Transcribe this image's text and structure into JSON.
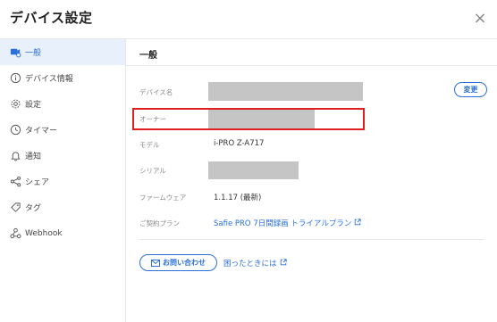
{
  "header": {
    "title": "デバイス設定",
    "close_glyph": "×"
  },
  "sidebar": {
    "items": [
      {
        "label": "一般",
        "icon": "camera-settings-icon",
        "active": true
      },
      {
        "label": "デバイス情報",
        "icon": "info-icon"
      },
      {
        "label": "設定",
        "icon": "gear-icon"
      },
      {
        "label": "タイマー",
        "icon": "clock-icon"
      },
      {
        "label": "通知",
        "icon": "bell-icon"
      },
      {
        "label": "シェア",
        "icon": "share-icon"
      },
      {
        "label": "タグ",
        "icon": "tag-icon"
      },
      {
        "label": "Webhook",
        "icon": "webhook-icon"
      }
    ]
  },
  "main": {
    "section_title": "一般",
    "rows": {
      "device_name_label": "デバイス名",
      "owner_label": "オーナー",
      "model_label": "モデル",
      "model_value": "i-PRO Z-A717",
      "serial_label": "シリアル",
      "firmware_label": "ファームウェア",
      "firmware_value": "1.1.17 (最新)",
      "plan_label": "ご契約プラン",
      "plan_value": "Safie PRO 7日間録画 トライアルプラン"
    },
    "change_button": "変更",
    "contact_button": "お問い合わせ",
    "help_link": "困ったときには"
  },
  "colors": {
    "accent": "#2b6fd8",
    "highlight": "#e02020",
    "redaction": "#c5c5c5"
  }
}
